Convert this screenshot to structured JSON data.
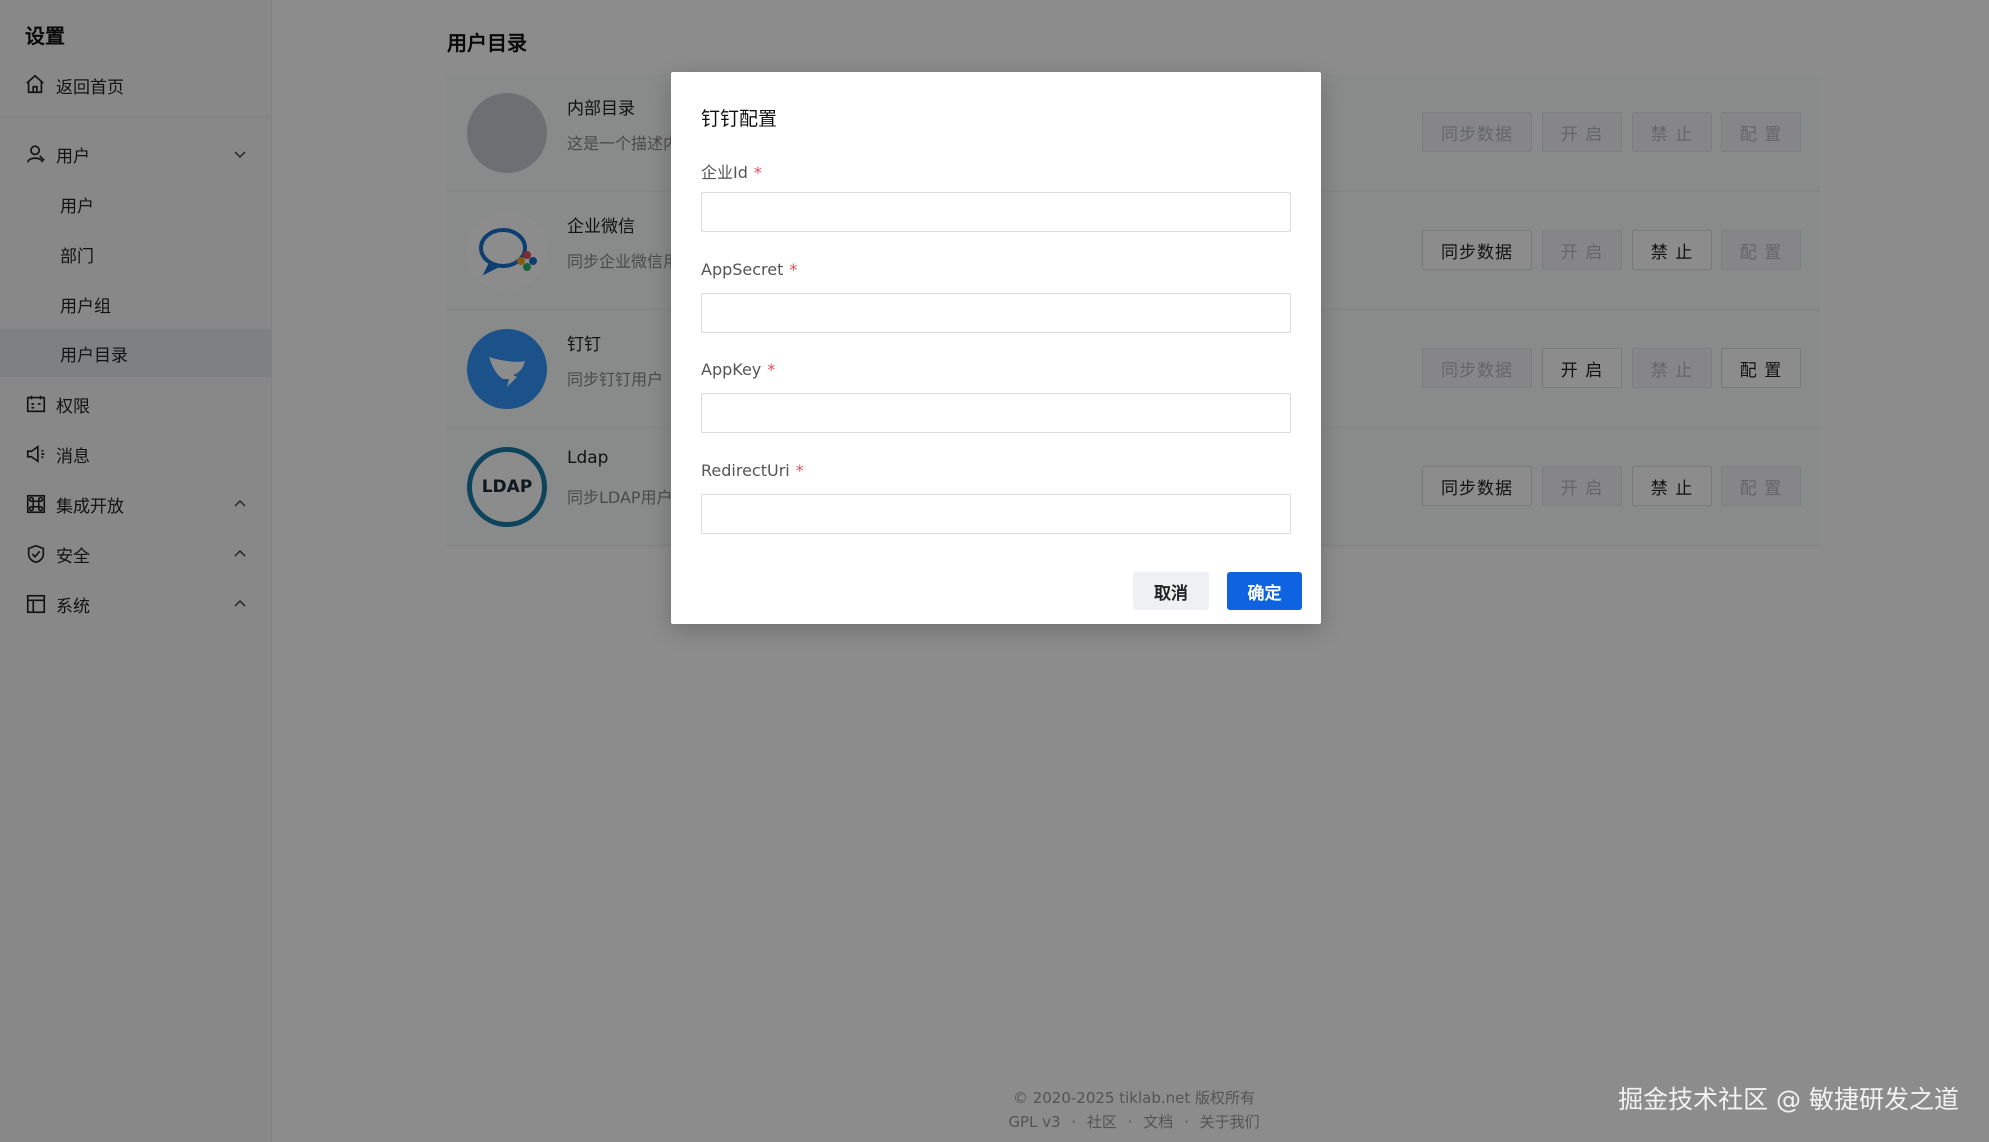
{
  "sidebar": {
    "title": "设置",
    "home": "返回首页",
    "user_group": "用户",
    "sub_items": [
      "用户",
      "部门",
      "用户组",
      "用户目录"
    ],
    "items": [
      "权限",
      "消息",
      "集成开放",
      "安全",
      "系统"
    ]
  },
  "main": {
    "title": "用户目录",
    "rows": [
      {
        "name": "内部目录",
        "desc": "这是一个描述内"
      },
      {
        "name": "企业微信",
        "desc": "同步企业微信用"
      },
      {
        "name": "钉钉",
        "desc": "同步钉钉用户"
      },
      {
        "name": "Ldap",
        "desc": "同步LDAP用户"
      }
    ],
    "buttons": {
      "sync": "同步数据",
      "open": "开 启",
      "ban": "禁 止",
      "config": "配 置"
    },
    "ldap_logo_text": "LDAP"
  },
  "footer": {
    "copyright": "© 2020-2025 tiklab.net 版权所有",
    "links": [
      "GPL v3",
      "社区",
      "文档",
      "关于我们"
    ],
    "sep": "·"
  },
  "modal": {
    "title": "钉钉配置",
    "fields": [
      {
        "label": "企业Id",
        "value": "",
        "placeholder": ""
      },
      {
        "label": "AppSecret",
        "value": "",
        "placeholder": ""
      },
      {
        "label": "AppKey",
        "value": "",
        "placeholder": ""
      },
      {
        "label": "RedirectUri",
        "value": "",
        "placeholder": ""
      }
    ],
    "required_mark": "*",
    "cancel": "取消",
    "ok": "确定"
  },
  "watermark": "掘金技术社区 @ 敏捷研发之道",
  "colors": {
    "primary": "#0f63e0",
    "required": "#e34d59",
    "dingtalk": "#3296fa",
    "ldap": "#1a7aa8"
  }
}
